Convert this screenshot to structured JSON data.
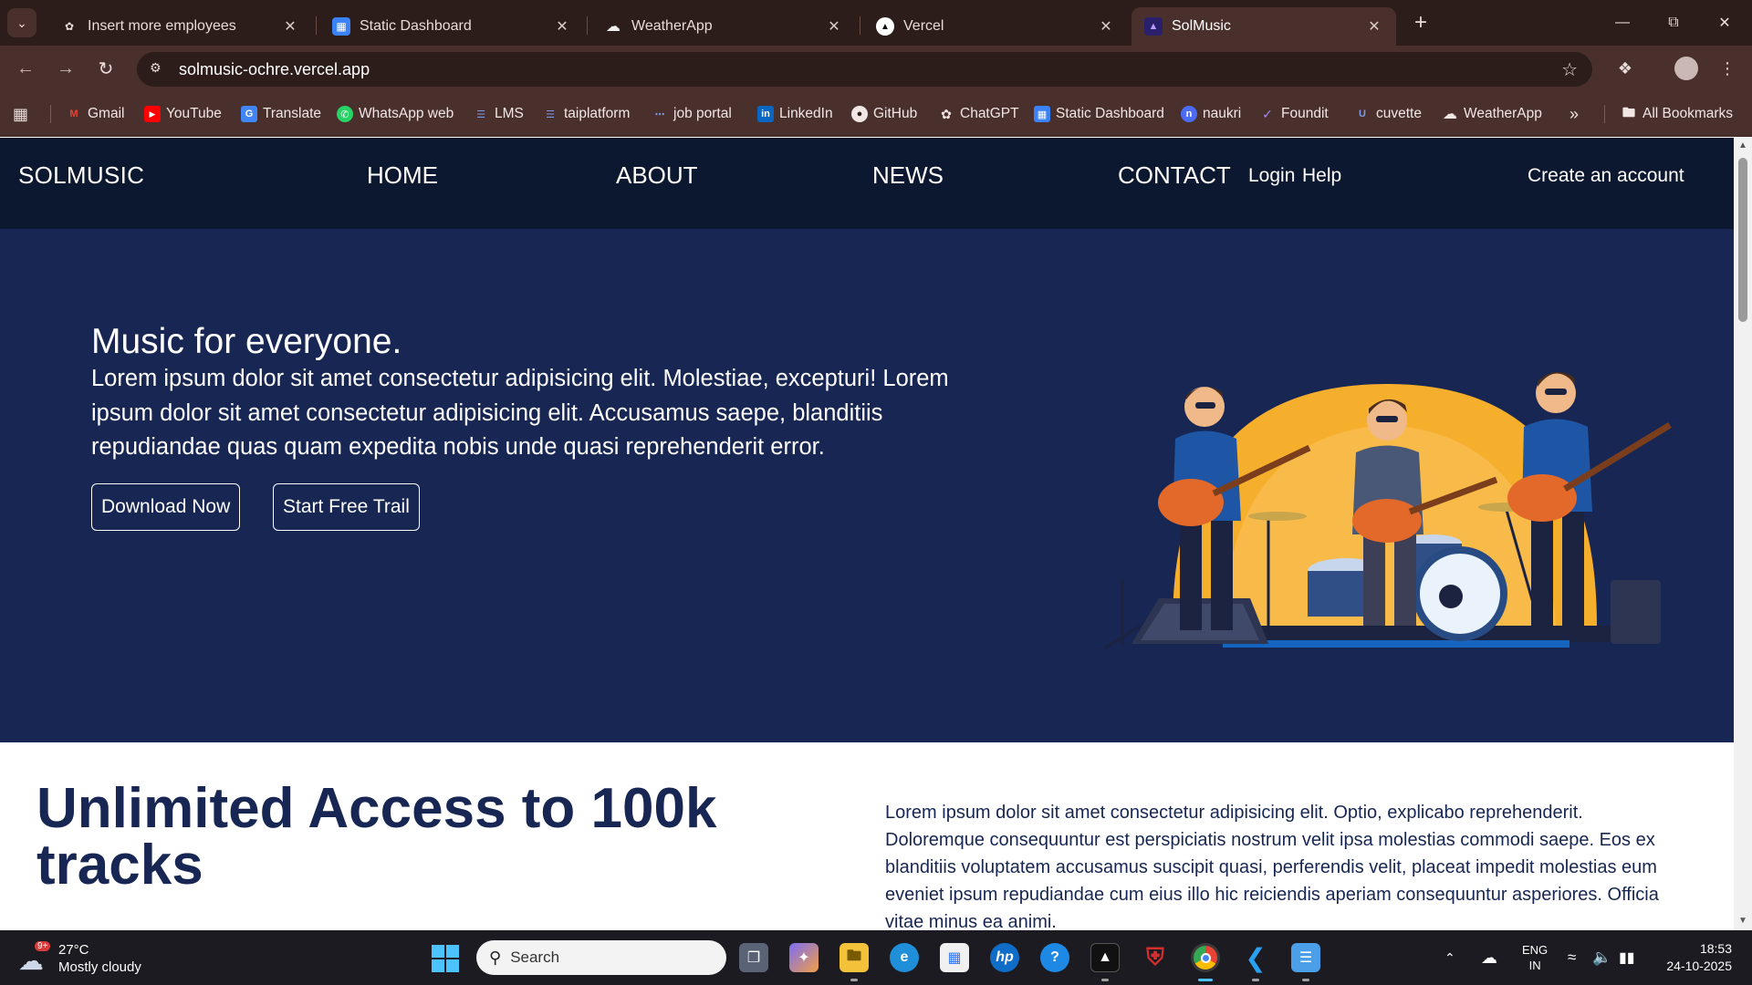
{
  "browser": {
    "tabs": [
      {
        "title": "Insert more employees",
        "favicon": "openai-icon",
        "active": false
      },
      {
        "title": "Static Dashboard",
        "favicon": "dashboard-icon",
        "active": false
      },
      {
        "title": "WeatherApp",
        "favicon": "cloud-icon",
        "active": false
      },
      {
        "title": "Vercel",
        "favicon": "vercel-icon",
        "active": false
      },
      {
        "title": "SolMusic",
        "favicon": "solmusic-icon",
        "active": true
      }
    ],
    "url": "solmusic-ochre.vercel.app",
    "bookmarks": [
      {
        "label": "Gmail",
        "icon": "gmail-icon",
        "color": "#ea4335"
      },
      {
        "label": "YouTube",
        "icon": "youtube-icon",
        "color": "#ff0000"
      },
      {
        "label": "Translate",
        "icon": "translate-icon",
        "color": "#4285f4"
      },
      {
        "label": "WhatsApp web",
        "icon": "whatsapp-icon",
        "color": "#25d366"
      },
      {
        "label": "LMS",
        "icon": "lms-icon",
        "color": "#5b7bd5"
      },
      {
        "label": "taiplatform",
        "icon": "taiplatform-icon",
        "color": "#5b7bd5"
      },
      {
        "label": "job portal",
        "icon": "job-portal-icon",
        "color": "#5b7bd5"
      },
      {
        "label": "LinkedIn",
        "icon": "linkedin-icon",
        "color": "#0a66c2"
      },
      {
        "label": "GitHub",
        "icon": "github-icon",
        "color": "#f0e6e3"
      },
      {
        "label": "ChatGPT",
        "icon": "chatgpt-icon",
        "color": "#f0e6e3"
      },
      {
        "label": "Static Dashboard",
        "icon": "dashboard-icon",
        "color": "#3b82f6"
      },
      {
        "label": "naukri",
        "icon": "naukri-icon",
        "color": "#4a6cf7"
      },
      {
        "label": "Foundit",
        "icon": "foundit-icon",
        "color": "#7b4fd6"
      },
      {
        "label": "cuvette",
        "icon": "cuvette-icon",
        "color": "#3b5bdb"
      },
      {
        "label": "WeatherApp",
        "icon": "cloud-icon",
        "color": "#f0e6e3"
      }
    ],
    "all_bookmarks_label": "All Bookmarks"
  },
  "site": {
    "brand": "SOLMUSIC",
    "nav": {
      "home": "HOME",
      "about": "ABOUT",
      "news": "NEWS",
      "contact": "CONTACT",
      "login": "Login",
      "help": "Help",
      "create_account": "Create an account"
    },
    "hero": {
      "title": "Music for everyone.",
      "text": "Lorem ipsum dolor sit amet consectetur adipisicing elit. Molestiae, excepturi! Lorem ipsum dolor sit amet consectetur adipisicing elit. Accusamus saepe, blanditiis repudiandae quas quam expedita nobis unde quasi reprehenderit error.",
      "download_label": "Download Now",
      "trial_label": "Start Free Trail"
    },
    "section2": {
      "heading": "Unlimited Access to 100k tracks",
      "text": "Lorem ipsum dolor sit amet consectetur adipisicing elit. Optio, explicabo reprehenderit. Doloremque consequuntur est perspiciatis nostrum velit ipsa molestias commodi saepe. Eos ex blanditiis voluptatem accusamus suscipit quasi, perferendis velit, placeat impedit molestias eum eveniet ipsum repudiandae cum eius illo hic reiciendis aperiam consequuntur asperiores. Officia vitae minus ea animi."
    },
    "colors": {
      "nav_bg": "#0c1730",
      "hero_bg": "#172652",
      "heading": "#172652"
    }
  },
  "taskbar": {
    "weather": {
      "temp": "27°C",
      "condition": "Mostly cloudy",
      "badge": "9+"
    },
    "search_placeholder": "Search",
    "language": {
      "line1": "ENG",
      "line2": "IN"
    },
    "time": "18:53",
    "date": "24-10-2025"
  }
}
